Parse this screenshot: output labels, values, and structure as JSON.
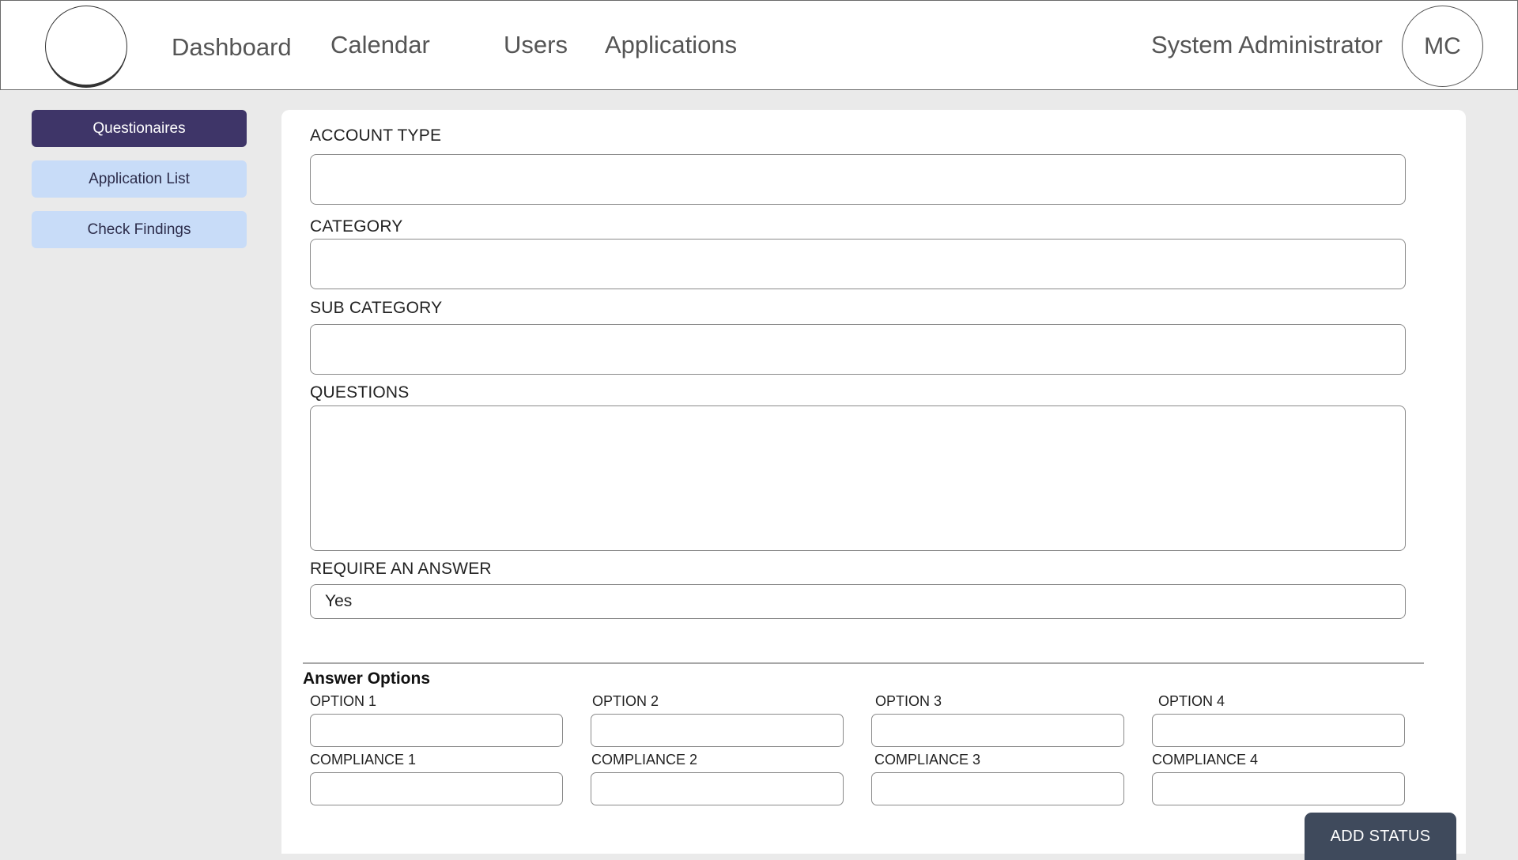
{
  "header": {
    "nav": {
      "dashboard": "Dashboard",
      "calendar": "Calendar",
      "users": "Users",
      "applications": "Applications"
    },
    "user_role": "System Administrator",
    "avatar_initials": "MC"
  },
  "sidebar": {
    "items": [
      {
        "label": "Questionaires",
        "active": true
      },
      {
        "label": "Application List",
        "active": false
      },
      {
        "label": "Check Findings",
        "active": false
      }
    ]
  },
  "form": {
    "account_type_label": "ACCOUNT TYPE",
    "account_type_value": "",
    "category_label": "CATEGORY",
    "category_value": "",
    "sub_category_label": "SUB CATEGORY",
    "sub_category_value": "",
    "questions_label": "QUESTIONS",
    "questions_value": "",
    "require_answer_label": "REQUIRE AN ANSWER",
    "require_answer_value": "Yes"
  },
  "answer_options": {
    "title": "Answer Options",
    "options": [
      "OPTION 1",
      "OPTION 2",
      "OPTION 3",
      "OPTION 4"
    ],
    "compliance": [
      "COMPLIANCE 1",
      "COMPLIANCE 2",
      "COMPLIANCE 3",
      "COMPLIANCE 4"
    ]
  },
  "actions": {
    "add_status": "ADD STATUS"
  },
  "colors": {
    "active_sidebar": "#3e3568",
    "inactive_sidebar": "#c8dcf8",
    "add_button": "#3f4a5c",
    "background": "#eaeaea"
  }
}
